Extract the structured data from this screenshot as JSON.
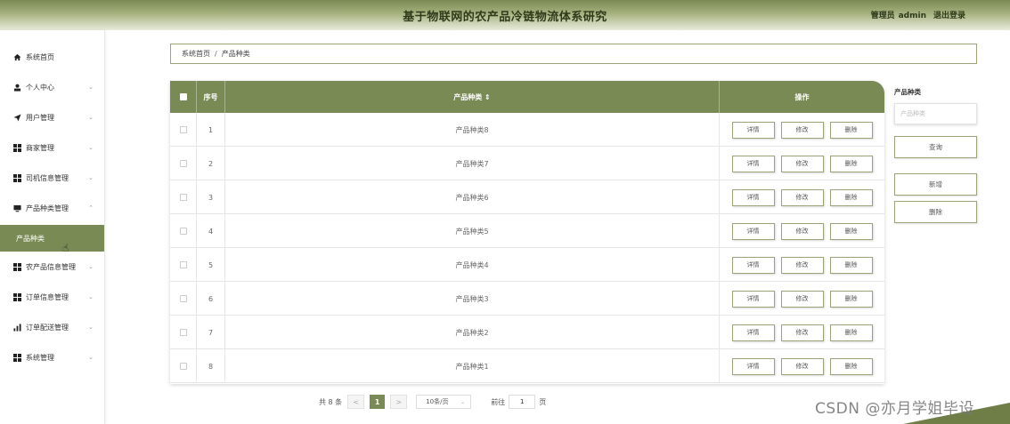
{
  "header": {
    "title": "基于物联网的农产品冷链物流体系研究",
    "role": "管理员",
    "username": "admin",
    "logout": "退出登录"
  },
  "sidebar": {
    "items": [
      {
        "label": "系统首页",
        "icon": "home-icon"
      },
      {
        "label": "个人中心",
        "icon": "user-icon"
      },
      {
        "label": "用户管理",
        "icon": "send-icon"
      },
      {
        "label": "商家管理",
        "icon": "grid-icon"
      },
      {
        "label": "司机信息管理",
        "icon": "grid-icon"
      },
      {
        "label": "产品种类管理",
        "icon": "monitor-icon"
      },
      {
        "label": "产品种类",
        "icon": ""
      },
      {
        "label": "农产品信息管理",
        "icon": "grid-icon"
      },
      {
        "label": "订单信息管理",
        "icon": "grid-icon"
      },
      {
        "label": "订单配送管理",
        "icon": "bar-chart-icon"
      },
      {
        "label": "系统管理",
        "icon": "grid-icon"
      }
    ]
  },
  "breadcrumb": {
    "home": "系统首页",
    "separator": "/",
    "current": "产品种类"
  },
  "table": {
    "headers": {
      "index": "序号",
      "name": "产品种类 ⇕",
      "ops": "操作"
    },
    "rows": [
      {
        "index": "1",
        "name": "产品种类8"
      },
      {
        "index": "2",
        "name": "产品种类7"
      },
      {
        "index": "3",
        "name": "产品种类6"
      },
      {
        "index": "4",
        "name": "产品种类5"
      },
      {
        "index": "5",
        "name": "产品种类4"
      },
      {
        "index": "6",
        "name": "产品种类3"
      },
      {
        "index": "7",
        "name": "产品种类2"
      },
      {
        "index": "8",
        "name": "产品种类1"
      }
    ],
    "row_actions": {
      "detail": "详情",
      "edit": "修改",
      "delete": "删除"
    }
  },
  "search_panel": {
    "label": "产品种类",
    "placeholder": "产品种类",
    "query": "查询",
    "add": "新增",
    "delete": "删除"
  },
  "pagination": {
    "total": "共 8 条",
    "prev": "<",
    "current_page": "1",
    "next": ">",
    "page_size": "10条/页",
    "goto_label": "前往",
    "goto_value": "1",
    "page_suffix": "页"
  },
  "watermark": "CSDN @亦月学姐毕设",
  "colors": {
    "accent": "#7a8a55",
    "border": "#9aa379"
  }
}
